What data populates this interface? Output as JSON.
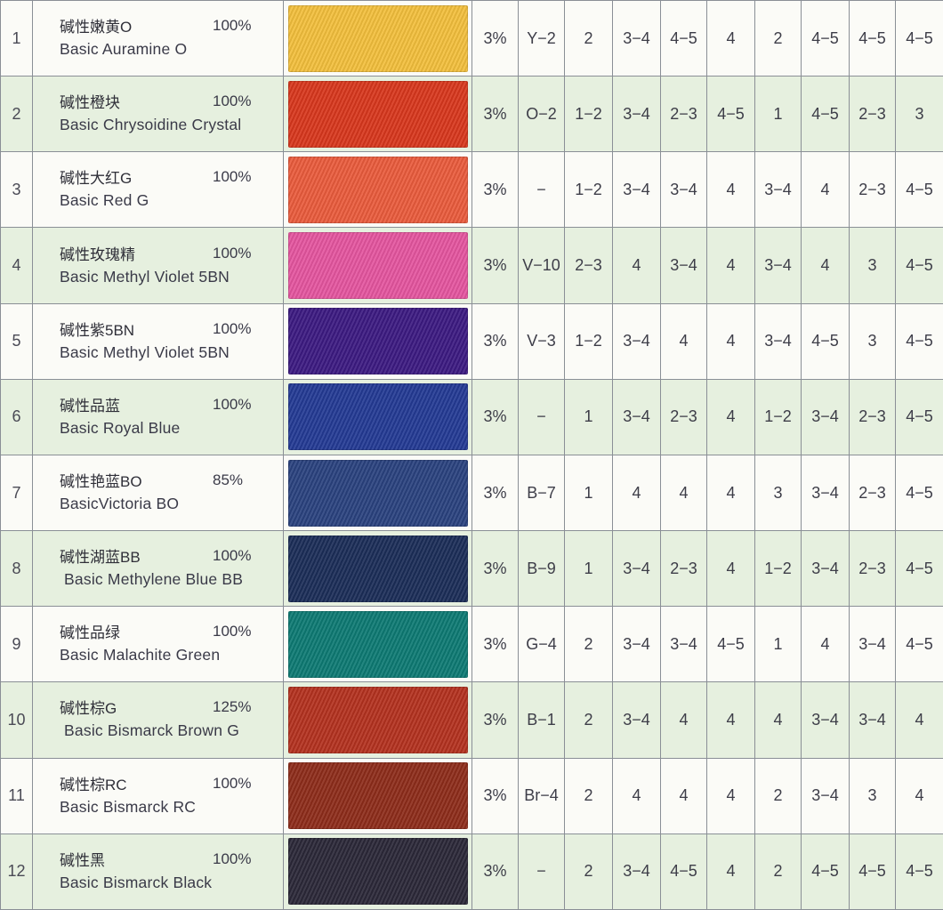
{
  "rows": [
    {
      "no": "1",
      "cn": "碱性嫩黄O",
      "pct": "100%",
      "en": "Basic Auramine O",
      "color": "#f3bf3c",
      "conc": "3%",
      "ci": "Y−2",
      "v1": "2",
      "v2": "3−4",
      "v3": "4−5",
      "v4": "4",
      "v5": "2",
      "v6": "4−5",
      "v7": "4−5",
      "v8": "4−5"
    },
    {
      "no": "2",
      "cn": "碱性橙块",
      "pct": "100%",
      "en": "Basic Chrysoidine Crystal",
      "color": "#d8371d",
      "conc": "3%",
      "ci": "O−2",
      "v1": "1−2",
      "v2": "3−4",
      "v3": "2−3",
      "v4": "4−5",
      "v5": "1",
      "v6": "4−5",
      "v7": "2−3",
      "v8": "3"
    },
    {
      "no": "3",
      "cn": "碱性大红G",
      "pct": "100%",
      "en": "Basic Red G",
      "color": "#ea5b3c",
      "conc": "3%",
      "ci": "−",
      "v1": "1−2",
      "v2": "3−4",
      "v3": "3−4",
      "v4": "4",
      "v5": "3−4",
      "v6": "4",
      "v7": "2−3",
      "v8": "4−5"
    },
    {
      "no": "4",
      "cn": "碱性玫瑰精",
      "pct": "100%",
      "en": "Basic Methyl Violet 5BN",
      "color": "#e5559f",
      "conc": "3%",
      "ci": "V−10",
      "v1": "2−3",
      "v2": "4",
      "v3": "3−4",
      "v4": "4",
      "v5": "3−4",
      "v6": "4",
      "v7": "3",
      "v8": "4−5"
    },
    {
      "no": "5",
      "cn": "碱性紫5BN",
      "pct": "100%",
      "en": "Basic Methyl Violet 5BN",
      "color": "#3c1a82",
      "conc": "3%",
      "ci": "V−3",
      "v1": "1−2",
      "v2": "3−4",
      "v3": "4",
      "v4": "4",
      "v5": "3−4",
      "v6": "4−5",
      "v7": "3",
      "v8": "4−5"
    },
    {
      "no": "6",
      "cn": "碱性品蓝",
      "pct": "100%",
      "en": "Basic Royal Blue",
      "color": "#233a94",
      "conc": "3%",
      "ci": "−",
      "v1": "1",
      "v2": "3−4",
      "v3": "2−3",
      "v4": "4",
      "v5": "1−2",
      "v6": "3−4",
      "v7": "2−3",
      "v8": "4−5"
    },
    {
      "no": "7",
      "cn": "碱性艳蓝BO",
      "pct": "85%",
      "en": "BasicVictoria BO",
      "color": "#2a427f",
      "conc": "3%",
      "ci": "B−7",
      "v1": "1",
      "v2": "4",
      "v3": "4",
      "v4": "4",
      "v5": "3",
      "v6": "3−4",
      "v7": "2−3",
      "v8": "4−5"
    },
    {
      "no": "8",
      "cn": "碱性湖蓝BB",
      "pct": "100%",
      "en": " Basic Methylene Blue BB",
      "color": "#1b2d58",
      "conc": "3%",
      "ci": "B−9",
      "v1": "1",
      "v2": "3−4",
      "v3": "2−3",
      "v4": "4",
      "v5": "1−2",
      "v6": "3−4",
      "v7": "2−3",
      "v8": "4−5"
    },
    {
      "no": "9",
      "cn": "碱性品绿",
      "pct": "100%",
      "en": "Basic Malachite Green",
      "color": "#0d7a73",
      "conc": "3%",
      "ci": "G−4",
      "v1": "2",
      "v2": "3−4",
      "v3": "3−4",
      "v4": "4−5",
      "v5": "1",
      "v6": "4",
      "v7": "3−4",
      "v8": "4−5"
    },
    {
      "no": "10",
      "cn": "碱性棕G",
      "pct": "125%",
      "en": " Basic Bismarck Brown G",
      "color": "#b4321f",
      "conc": "3%",
      "ci": "B−1",
      "v1": "2",
      "v2": "3−4",
      "v3": "4",
      "v4": "4",
      "v5": "4",
      "v6": "3−4",
      "v7": "3−4",
      "v8": "4"
    },
    {
      "no": "11",
      "cn": "碱性棕RC",
      "pct": "100%",
      "en": "Basic Bismarck RC",
      "color": "#8e2c1a",
      "conc": "3%",
      "ci": "Br−4",
      "v1": "2",
      "v2": "4",
      "v3": "4",
      "v4": "4",
      "v5": "2",
      "v6": "3−4",
      "v7": "3",
      "v8": "4"
    },
    {
      "no": "12",
      "cn": "碱性黑",
      "pct": "100%",
      "en": "Basic Bismarck Black",
      "color": "#2b2838",
      "conc": "3%",
      "ci": "−",
      "v1": "2",
      "v2": "3−4",
      "v3": "4−5",
      "v4": "4",
      "v5": "2",
      "v6": "4−5",
      "v7": "4−5",
      "v8": "4−5"
    }
  ]
}
